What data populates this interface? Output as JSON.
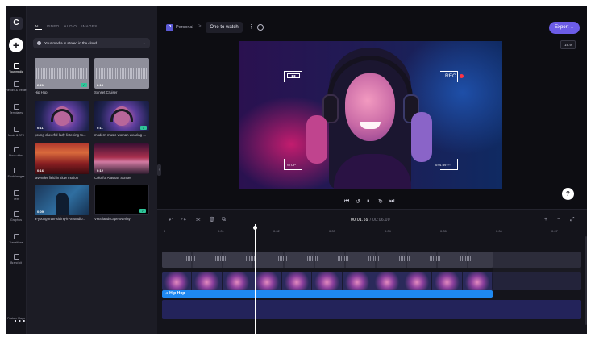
{
  "rail": {
    "logo": "C",
    "items": [
      {
        "label": "Your media",
        "active": true
      },
      {
        "label": "Record & create"
      },
      {
        "label": "Templates"
      },
      {
        "label": "Music & SFX"
      },
      {
        "label": "Stock video"
      },
      {
        "label": "Stock images"
      },
      {
        "label": "Text"
      },
      {
        "label": "Graphics"
      },
      {
        "label": "Transitions"
      },
      {
        "label": "Brand kit"
      }
    ],
    "bottom_label": "Feature Flags"
  },
  "media": {
    "tabs": [
      "ALL",
      "VIDEO",
      "AUDIO",
      "IMAGES"
    ],
    "cloud_notice": "Your media is stored in the cloud",
    "items": [
      {
        "name": "Hip Hop",
        "duration": "2:21",
        "check": true
      },
      {
        "name": "Sunset Cruiser",
        "duration": "2:13",
        "check": false
      },
      {
        "name": "young-cheerful-lady-listening-to...",
        "duration": "0:11",
        "check": false
      },
      {
        "name": "modern-music-woman-wearing-...",
        "duration": "0:11",
        "check": true
      },
      {
        "name": "lavender field in slow motion",
        "duration": "0:16",
        "check": false
      },
      {
        "name": "Colorful Alaskan Sunset",
        "duration": "0:12",
        "check": false
      },
      {
        "name": "a-young-man-sitting-in-a-studio...",
        "duration": "0:09",
        "check": false
      },
      {
        "name": "VHS landscape overlay",
        "duration": "",
        "check": true
      }
    ]
  },
  "topbar": {
    "workspace_badge": "P",
    "workspace": "Personal",
    "separator": ">",
    "project_title": "One to watch",
    "export_label": "Export",
    "export_chevron": "⌄",
    "aspect_ratio": "16:9"
  },
  "preview": {
    "rec_label": "REC",
    "stop_label": "STOP",
    "battery_label": "▮▮▮",
    "overlay_time": "0:01:59 ◦◦◦",
    "help_label": "?"
  },
  "playback": {
    "prev": "⏮",
    "back5": "↺",
    "pause": "⏸",
    "fwd5": "↻",
    "next": "⏭"
  },
  "timeline": {
    "current_time": "00:01.59",
    "total_time": "00:06.00",
    "time_separator": " / ",
    "tools": {
      "undo": "↶",
      "redo": "↷",
      "cut": "✂",
      "delete": "🗑",
      "copy": "⧉",
      "add": "+",
      "zoom_out": "−",
      "fit": "⤢"
    },
    "ruler_ticks": [
      "0",
      "0:01",
      "0:02",
      "0:03",
      "0:04",
      "0:05",
      "0:06",
      "0:07"
    ],
    "audio_clip_label": "♫ Hip Hop"
  }
}
